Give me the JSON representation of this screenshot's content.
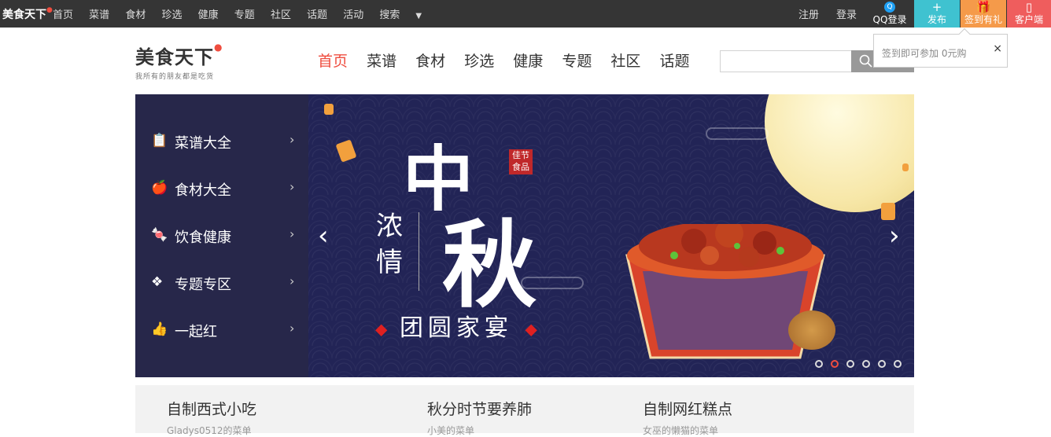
{
  "topbar": {
    "logo": "美食天下",
    "nav": [
      "首页",
      "菜谱",
      "食材",
      "珍选",
      "健康",
      "专题",
      "社区",
      "话题",
      "活动",
      "搜索"
    ],
    "register": "注册",
    "login": "登录",
    "qq_login": "QQ登录",
    "publish": "发布",
    "signin_gift": "签到有礼",
    "client": "客户端",
    "colors": {
      "bg": "#353535",
      "publish": "#3fc2d0",
      "signin": "#f59a4a",
      "client": "#ef5d5d"
    }
  },
  "header": {
    "logo_text": "美食天下",
    "logo_slogan": "我所有的朋友都是吃货",
    "nav": [
      "首页",
      "菜谱",
      "食材",
      "珍选",
      "健康",
      "专题",
      "社区",
      "话题"
    ],
    "active_index": 0,
    "search_placeholder": ""
  },
  "popup": {
    "text": "签到即可参加 0元购",
    "close": "×"
  },
  "banner": {
    "side_menu": [
      {
        "icon": "clipboard-icon",
        "glyph": "📋",
        "label": "菜谱大全"
      },
      {
        "icon": "apple-icon",
        "glyph": "🍎",
        "label": "食材大全"
      },
      {
        "icon": "candy-icon",
        "glyph": "🍬",
        "label": "饮食健康"
      },
      {
        "icon": "diamond-icon",
        "glyph": "❖",
        "label": "专题专区"
      },
      {
        "icon": "thumbs-up-icon",
        "glyph": "👍",
        "label": "一起红"
      }
    ],
    "chevron": "›",
    "slide": {
      "title_char1": "中",
      "title_char2": "秋",
      "vertical_text": "浓情",
      "seal_text": "佳节食品",
      "subtitle": "团圆家宴"
    },
    "prev": "‹",
    "next": "›",
    "dot_count": 6,
    "active_dot": 1
  },
  "strip": [
    {
      "title": "自制西式小吃",
      "author": "Gladys0512的菜单"
    },
    {
      "title": "秋分时节要养肺",
      "author": "小美的菜单"
    },
    {
      "title": "自制网红糕点",
      "author": "女巫的懒猫的菜单"
    }
  ]
}
